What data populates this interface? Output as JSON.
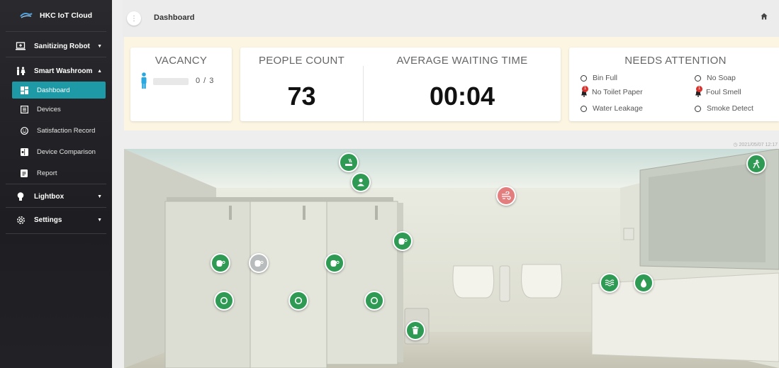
{
  "brand": {
    "name": "HKC IoT Cloud"
  },
  "sidebar": {
    "sanitizing": "Sanitizing Robot",
    "washroom": "Smart Washroom",
    "sub": [
      "Dashboard",
      "Devices",
      "Satisfaction Record",
      "Device Comparison",
      "Report"
    ],
    "lightbox": "Lightbox",
    "settings": "Settings"
  },
  "header": {
    "title": "Dashboard",
    "menu_glyph": "⋮"
  },
  "stats": {
    "vacancy_title": "VACANCY",
    "vacancy_value": "0 / 3",
    "vacancy_fraction": 0,
    "people_title": "PEOPLE COUNT",
    "people_value": "73",
    "wait_title": "AVERAGE WAITING TIME",
    "wait_value": "00:04",
    "attention_title": "NEEDS ATTENTION",
    "attention": [
      {
        "label": "Bin Full",
        "alert": false,
        "badge": ""
      },
      {
        "label": "No Soap",
        "alert": false,
        "badge": ""
      },
      {
        "label": "No Toilet Paper",
        "alert": true,
        "badge": "1"
      },
      {
        "label": "Foul Smell",
        "alert": true,
        "badge": "1"
      },
      {
        "label": "Water Leakage",
        "alert": false,
        "badge": ""
      },
      {
        "label": "Smoke Detect",
        "alert": false,
        "badge": ""
      }
    ]
  },
  "scene": {
    "timestamp": "2021/05/07 12:17"
  },
  "colors": {
    "accent": "#1e9aa6",
    "marker_green": "#2e9a53",
    "alert_red": "#d9332f",
    "banner": "#fcf5e2"
  }
}
